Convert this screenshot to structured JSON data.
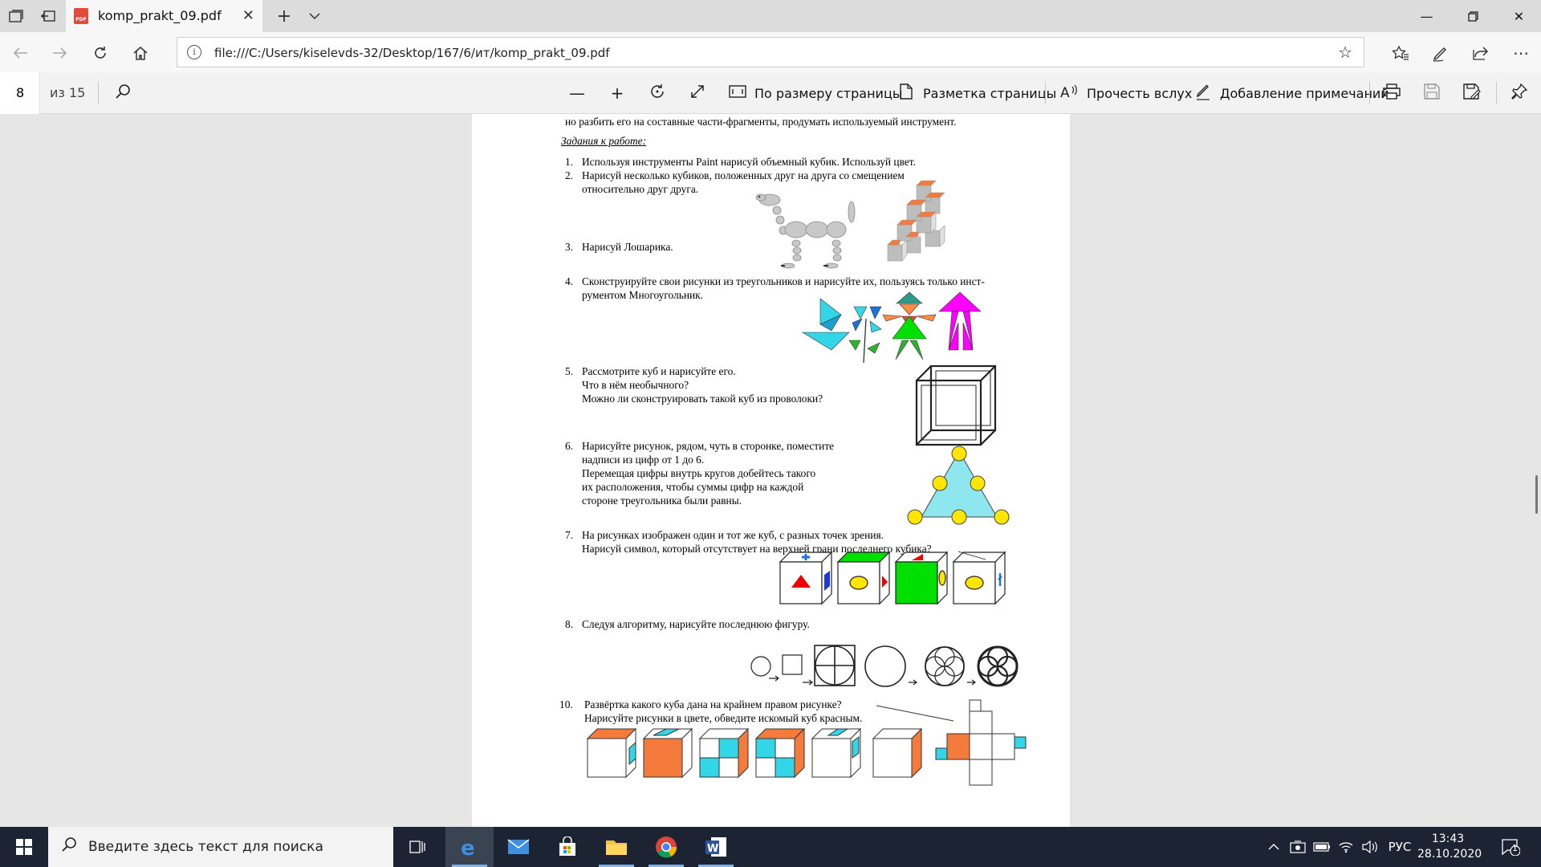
{
  "browser": {
    "tab_title": "komp_prakt_09.pdf",
    "pdf_badge": "PDF",
    "url": "file:///C:/Users/kiselevds-32/Desktop/167/6/ит/komp_prakt_09.pdf"
  },
  "pdf_toolbar": {
    "page_current": "8",
    "page_total": "из 15",
    "fit_page": "По размеру страницы",
    "page_layout": "Разметка страницы",
    "read_aloud": "Прочесть вслух",
    "add_notes": "Добавление примечаний"
  },
  "document": {
    "intro_line": "но разбить его на составные части-фрагменты, продумать используемый инструмент.",
    "heading": "Задания  к  работе",
    "heading_colon": ":",
    "task1": "Используя инструменты Paint нарисуй объемный кубик.  Используй цвет.",
    "task2_a": "Нарисуй несколько кубиков, положенных друг на друга со смещением",
    "task2_b": "относительно друг друга.",
    "task3": "Нарисуй Лошарика.",
    "task4_a": "Сконструируйте свои рисунки из треугольников и нарисуйте их, пользуясь только инст-",
    "task4_b": "рументом Многоугольник.",
    "task5_a": "Рассмотрите куб и нарисуйте  его.",
    "task5_b": "Что в нём необычного?",
    "task5_c": "Можно ли сконструировать такой куб из проволоки?",
    "task6_a": "Нарисуйте  рисунок, рядом, чуть в сторонке, поместите",
    "task6_b": "надписи из цифр от 1 до 6.",
    "task6_c": "Перемещая цифры внутрь кругов добейтесь такого",
    "task6_d": "их расположения, чтобы суммы цифр на каждой",
    "task6_e": "стороне треугольника были равны.",
    "task7_a": "На рисунках изображен один и тот же куб, с разных точек зрения.",
    "task7_b": "Нарисуй символ, который  отсутствует на верхней грани последнего кубика?",
    "task8": "Следуя алгоритму, нарисуйте  последнюю фигуру.",
    "task10_a": "Развёртка какого куба дана на крайнем правом рисунке?",
    "task10_b": "Нарисуйте рисунки в цвете, обведите искомый куб красным.",
    "numbers": [
      "1.",
      "2.",
      "3.",
      "4.",
      "5.",
      "6.",
      "7.",
      "8.",
      "10."
    ]
  },
  "taskbar": {
    "search_placeholder": "Введите здесь текст для поиска",
    "language": "РУС",
    "time": "13:43",
    "date": "28.10.2020",
    "notifications_count": "1"
  },
  "colors": {
    "orange": "#f47b3c",
    "cyan": "#33d6e6",
    "green": "#00e000",
    "yellow": "#ffe600",
    "magenta": "#ff00ff",
    "edge_blue": "#1a73d9"
  }
}
